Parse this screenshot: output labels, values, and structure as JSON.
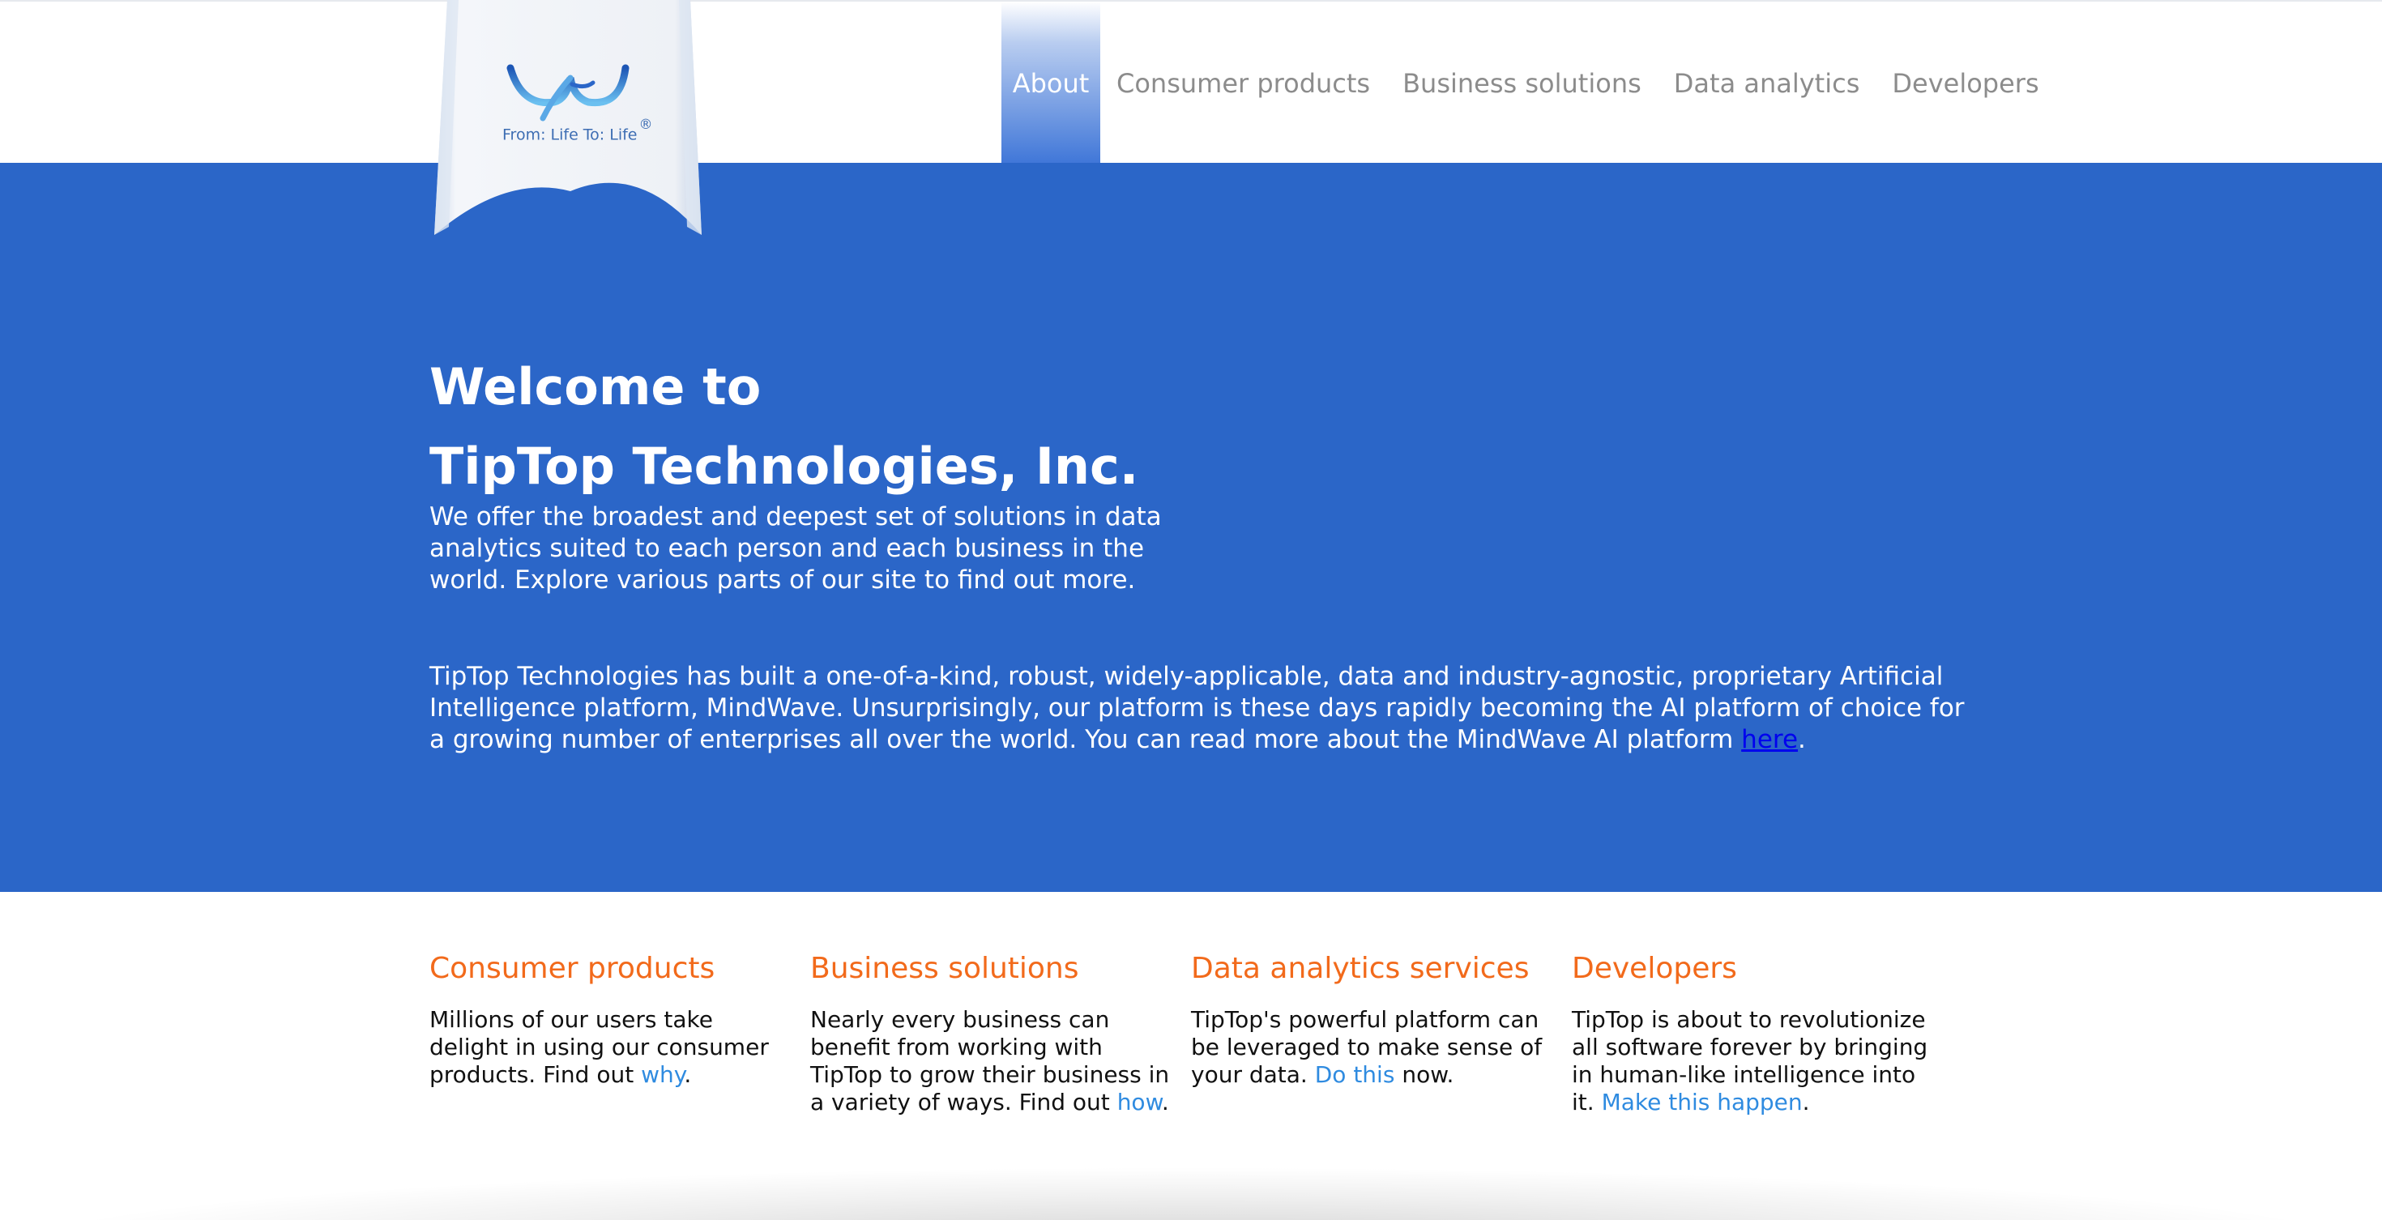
{
  "header": {
    "logo": {
      "tagline": "From: Life To: Life",
      "registered_mark": "®"
    },
    "nav": {
      "items": [
        {
          "label": "About",
          "active": true
        },
        {
          "label": "Consumer products",
          "active": false
        },
        {
          "label": "Business solutions",
          "active": false
        },
        {
          "label": "Data analytics",
          "active": false
        },
        {
          "label": "Developers",
          "active": false
        }
      ]
    }
  },
  "hero": {
    "title_line1": "Welcome to",
    "title_line2": "TipTop Technologies, Inc.",
    "intro": "We offer the broadest and deepest set of solutions in data analytics suited to each person and each business in the world. Explore various parts of our site to find out more.",
    "body_text": "TipTop Technologies has built a one-of-a-kind, robust, widely-applicable, data and industry-agnostic, proprietary Artificial Intelligence platform, MindWave. Unsurprisingly, our platform is these days rapidly becoming the AI platform of choice for a growing number of enterprises all over the world. You can read more about the MindWave AI platform ",
    "body_link": "here",
    "body_end": "."
  },
  "features": [
    {
      "title": "Consumer products",
      "text": "Millions of our users take delight in using our consumer products. Find out ",
      "link": "why",
      "end": "."
    },
    {
      "title": "Business solutions",
      "text": "Nearly every business can benefit from working with TipTop to grow their business in a variety of ways. Find out ",
      "link": "how",
      "end": "."
    },
    {
      "title": "Data analytics services",
      "text": "TipTop's powerful platform can be leveraged to make sense of your data. ",
      "link": "Do this",
      "end": " now."
    },
    {
      "title": "Developers",
      "text": "TipTop is about to revolutionize all software forever by bringing in human-like intelligence into it. ",
      "link": "Make this happen",
      "end": "."
    }
  ],
  "colors": {
    "hero_background": "#2b66c8",
    "feature_heading": "#f26a1b",
    "link_blue": "#2f8be0",
    "nav_text": "#8c8c8c"
  },
  "icons": [
    "logo-icon"
  ]
}
